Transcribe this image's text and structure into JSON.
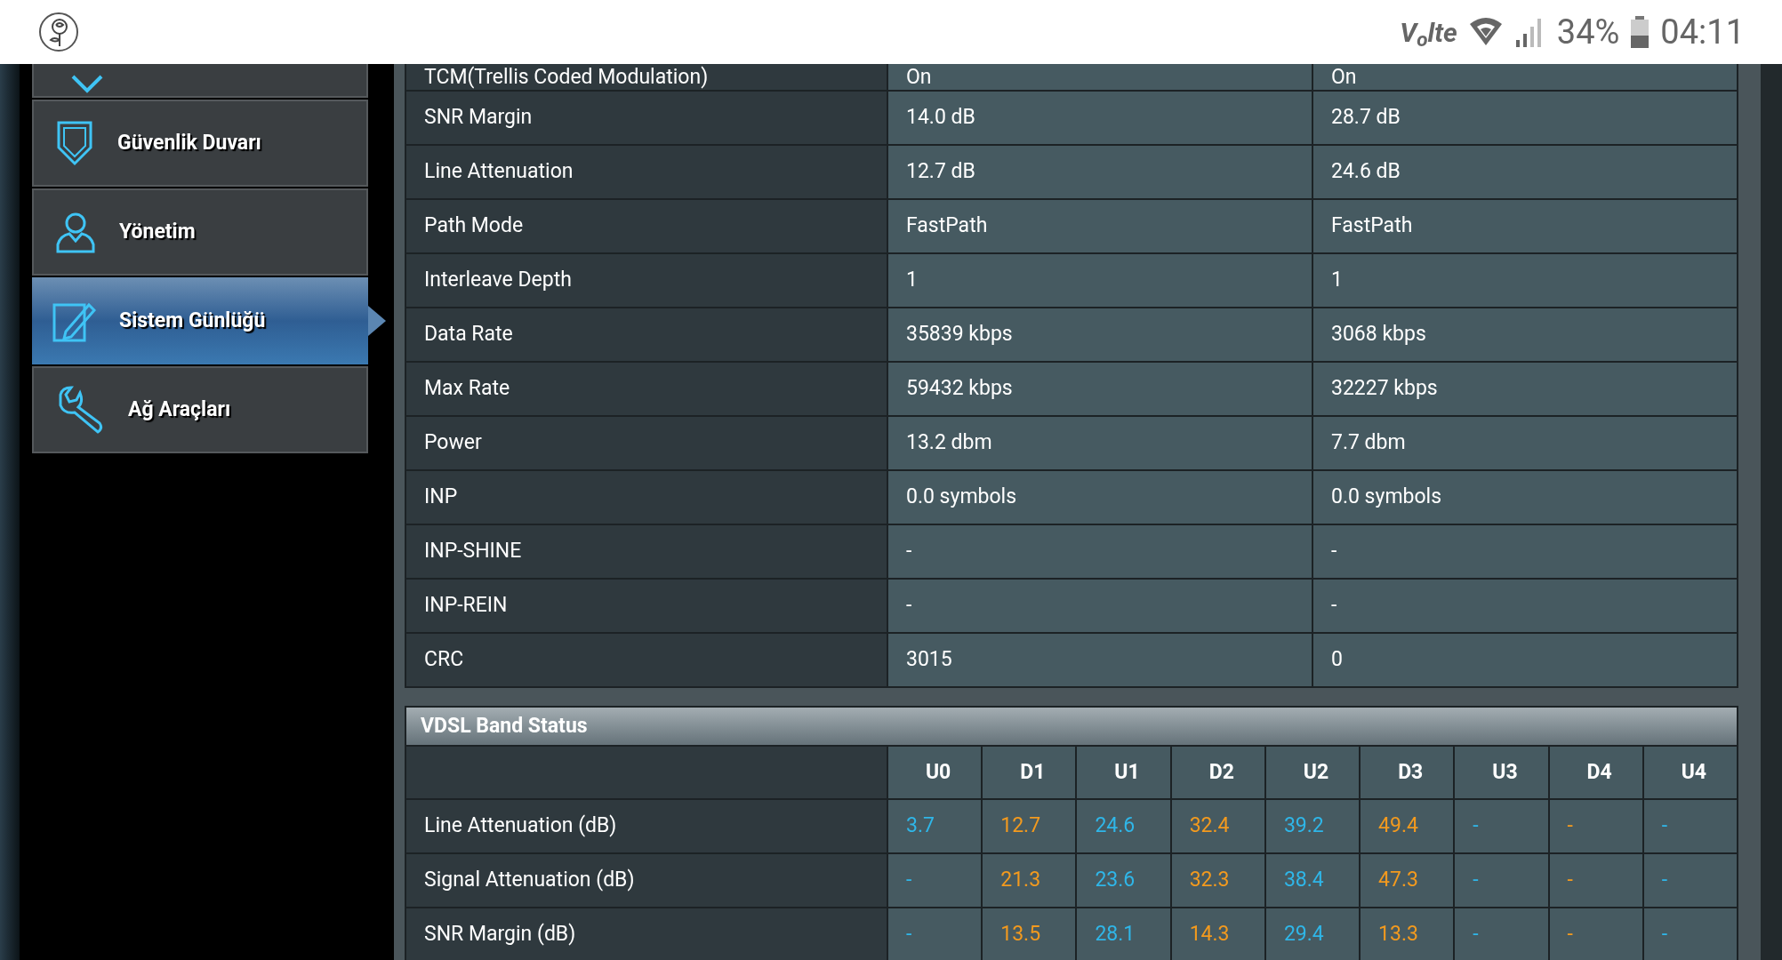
{
  "status_bar": {
    "network": "V$_{o}$lte",
    "battery": "34%",
    "time": "04:11"
  },
  "sidebar": {
    "items": [
      {
        "selected": false
      },
      {
        "label": "Güvenlik Duvarı",
        "selected": false
      },
      {
        "label": "Yönetim",
        "selected": false
      },
      {
        "label": "Sistem Günlüğü",
        "selected": true
      },
      {
        "label": "Ağ Araçları",
        "selected": false
      }
    ]
  },
  "line_table": {
    "rows": [
      [
        "TCM(Trellis Coded Modulation)",
        "On",
        "On"
      ],
      [
        "SNR Margin",
        "14.0 dB",
        "28.7 dB"
      ],
      [
        "Line Attenuation",
        "12.7 dB",
        "24.6 dB"
      ],
      [
        "Path Mode",
        "FastPath",
        "FastPath"
      ],
      [
        "Interleave Depth",
        "1",
        "1"
      ],
      [
        "Data Rate",
        "35839 kbps",
        "3068 kbps"
      ],
      [
        "Max Rate",
        "59432 kbps",
        "32227 kbps"
      ],
      [
        "Power",
        "13.2 dbm",
        "7.7 dbm"
      ],
      [
        "INP",
        "0.0 symbols",
        "0.0 symbols"
      ],
      [
        "INP-SHINE",
        "-",
        "-"
      ],
      [
        "INP-REIN",
        "-",
        "-"
      ],
      [
        "CRC",
        "3015",
        "0"
      ]
    ]
  },
  "band_status": {
    "title": "VDSL Band Status",
    "columns": [
      {
        "label": "U0",
        "color": "#2fb6e8"
      },
      {
        "label": "D1",
        "color": "#f39a1e"
      },
      {
        "label": "U1",
        "color": "#2fb6e8"
      },
      {
        "label": "D2",
        "color": "#f39a1e"
      },
      {
        "label": "U2",
        "color": "#2fb6e8"
      },
      {
        "label": "D3",
        "color": "#f39a1e"
      },
      {
        "label": "U3",
        "color": "#2fb6e8"
      },
      {
        "label": "D4",
        "color": "#f39a1e"
      },
      {
        "label": "U4",
        "color": "#2fb6e8"
      }
    ],
    "rows": [
      {
        "label": "Line Attenuation (dB)",
        "values": [
          "3.7",
          "12.7",
          "24.6",
          "32.4",
          "39.2",
          "49.4",
          "-",
          "-",
          "-"
        ]
      },
      {
        "label": "Signal Attenuation (dB)",
        "values": [
          "-",
          "21.3",
          "23.6",
          "32.3",
          "38.4",
          "47.3",
          "-",
          "-",
          "-"
        ]
      },
      {
        "label": "SNR Margin (dB)",
        "values": [
          "-",
          "13.5",
          "28.1",
          "14.3",
          "29.4",
          "13.3",
          "-",
          "-",
          "-"
        ]
      }
    ]
  }
}
